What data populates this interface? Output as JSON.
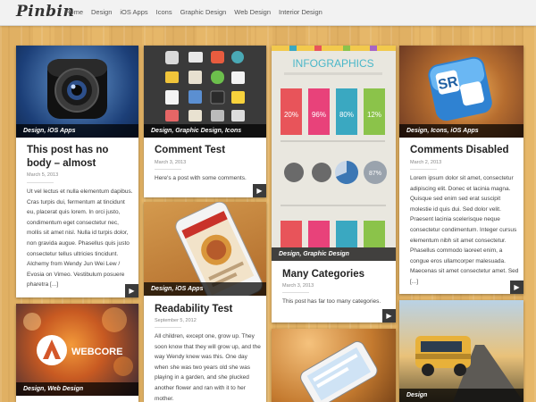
{
  "site": {
    "logo": "Pinbin",
    "nav": [
      "Home",
      "Design",
      "iOS Apps",
      "Icons",
      "Graphic Design",
      "Web Design",
      "Interior Design"
    ]
  },
  "posts": [
    {
      "caption": "Design, iOS Apps",
      "title": "This post has no body – almost",
      "date": "March 5, 2013",
      "body": "Ut vel lectus et nulla elementum dapibus. Cras turpis dui, fermentum at tincidunt eu, placerat quis lorem. In orci justo, condimentum eget consectetur nec, mollis sit amet nisl. Nulla id turpis dolor, non gravida augue. Phasellus quis justo consectetur tellus ultricies tincidunt. Alchemy from Wendy Jun Wei Lew / Evosia on Vimeo. Vestibulum posuere pharetra [...]"
    },
    {
      "caption": "Design, Graphic Design, Icons",
      "title": "Comment Test",
      "date": "March 3, 2013",
      "body": "Here's a post with some comments."
    },
    {
      "caption": "Design, iOS Apps",
      "title": "Readability Test",
      "date": "September 5, 2012",
      "body": "All children, except one, grow up. They soon know that they will grow up, and the way Wendy knew was this. One day when she was two years old she was playing in a garden, and she plucked another flower and ran with it to her mother."
    },
    {
      "caption": "Design, Graphic Design",
      "title": "Many Categories",
      "date": "March 3, 2013",
      "body": "This post has far too many categories.",
      "infographic": {
        "title": "INFOGRAPHICS",
        "stats": [
          "20%",
          "96%",
          "80%",
          "12%"
        ],
        "pie_label": "87%"
      }
    },
    {
      "caption": "Design, Icons, iOS Apps",
      "title": "Comments Disabled",
      "date": "March 2, 2013",
      "body": "Lorem ipsum dolor sit amet, consectetur adipiscing elit. Donec et lacinia magna. Quisque sed enim sed erat suscipit molestie id quis dui. Sed dolor velit. Praesent lacinia scelerisque neque consectetur condimentum. Integer cursus elementum nibh sit amet consectetur. Phasellus commodo laoreet enim, a congue eros ullamcorper malesuada. Maecenas sit amet consectetur amet. Sed [...]",
      "app_icon_text": "SR"
    },
    {
      "caption": "Design, Web Design",
      "logo_text": "WEBCORE"
    },
    {
      "caption": "Design"
    }
  ],
  "icons": {
    "arrow": "arrow-right-icon"
  }
}
